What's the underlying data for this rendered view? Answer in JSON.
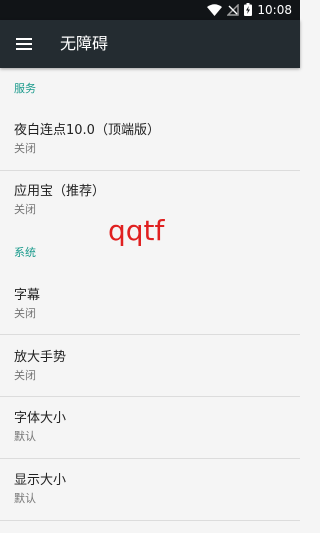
{
  "status_bar": {
    "time": "10:08",
    "icons": [
      "wifi-icon",
      "no-signal-icon",
      "battery-charging-icon"
    ]
  },
  "app_bar": {
    "title": "无障碍",
    "menu_icon": "menu-icon"
  },
  "sections": {
    "services": {
      "header": "服务",
      "items": [
        {
          "title": "夜白连点10.0（顶端版）",
          "summary": "关闭"
        },
        {
          "title": "应用宝（推荐）",
          "summary": "关闭"
        }
      ]
    },
    "system": {
      "header": "系统",
      "items": [
        {
          "title": "字幕",
          "summary": "关闭"
        },
        {
          "title": "放大手势",
          "summary": "关闭"
        },
        {
          "title": "字体大小",
          "summary": "默认"
        },
        {
          "title": "显示大小",
          "summary": "默认"
        }
      ]
    }
  },
  "overlay": {
    "text": "qqtf"
  },
  "colors": {
    "accent": "#1a9a8c",
    "app_bar": "#242c31",
    "status_bar": "#111417",
    "overlay_text": "#e02020"
  }
}
